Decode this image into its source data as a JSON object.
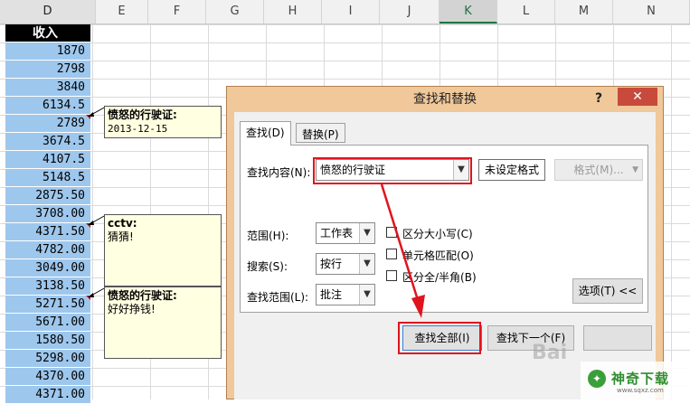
{
  "columns": [
    "D",
    "E",
    "F",
    "G",
    "H",
    "I",
    "J",
    "K",
    "L",
    "M",
    "N"
  ],
  "selected_column": "K",
  "sheet": {
    "header": "收入",
    "values": [
      "1870",
      "2798",
      "3840",
      "6134.5",
      "2789",
      "3674.5",
      "4107.5",
      "5148.5",
      "2875.50",
      "3708.00",
      "4371.50",
      "4782.00",
      "3049.00",
      "3138.50",
      "5271.50",
      "5671.00",
      "1580.50",
      "5298.00",
      "4370.00",
      "4371.00"
    ]
  },
  "comments": [
    {
      "title": "愤怒的行驶证:",
      "body": "2013-12-15"
    },
    {
      "title": "cctv:",
      "body": "猜猜!"
    },
    {
      "title": "愤怒的行驶证:",
      "body": "好好挣钱!"
    }
  ],
  "dialog": {
    "title": "查找和替换",
    "help": "?",
    "close": "✕",
    "tabs": [
      "查找(D)",
      "替换(P)"
    ],
    "find_label": "查找内容(N):",
    "find_value": "愤怒的行驶证",
    "format_status": "未设定格式",
    "format_button": "格式(M)...",
    "scope_label": "范围(H):",
    "scope_value": "工作表",
    "search_label": "搜索(S):",
    "search_value": "按行",
    "lookin_label": "查找范围(L):",
    "lookin_value": "批注",
    "match_case": "区分大小写(C)",
    "match_cell": "单元格匹配(O)",
    "match_width": "区分全/半角(B)",
    "options_button": "选项(T) <<",
    "find_all_button": "查找全部(I)",
    "find_next_button": "查找下一个(F)"
  },
  "watermark": {
    "logo": "神奇下载",
    "site": "www.sqxz.com",
    "baidu": "Bai"
  },
  "colors": {
    "accent_red": "#e0141e",
    "cell_fill": "#9ec7ed",
    "comment_fill": "#ffffe1",
    "dialog_frame": "#f0c89a"
  }
}
